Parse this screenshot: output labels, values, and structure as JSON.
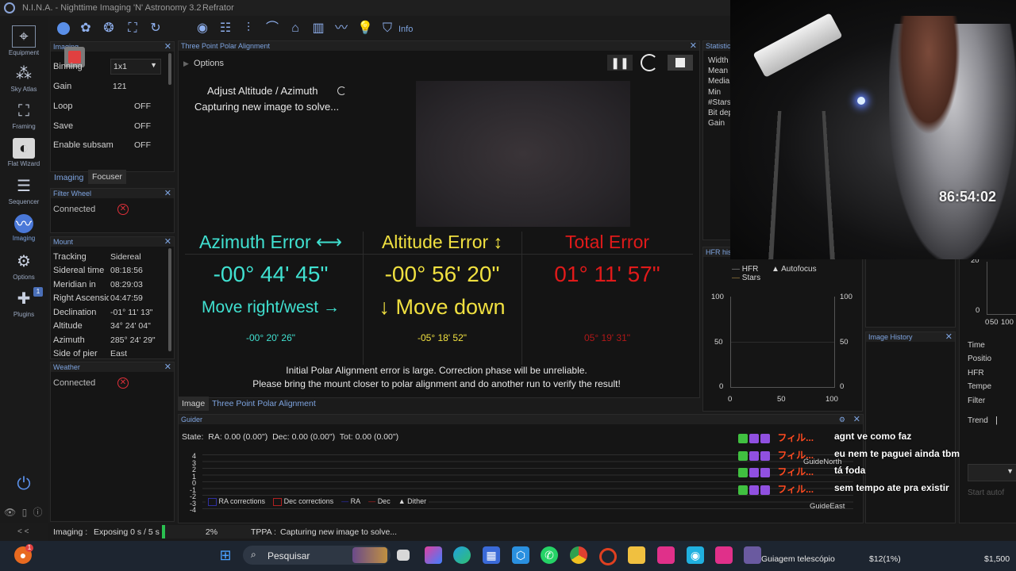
{
  "app": {
    "title": "N.I.N.A. - Nighttime Imaging 'N' Astronomy 3.2",
    "profile": "Refrator",
    "info_label": "Info"
  },
  "sidebar": {
    "items": [
      {
        "label": "Equipment",
        "icon": "telescope-icon"
      },
      {
        "label": "Sky Atlas",
        "icon": "star-map-icon"
      },
      {
        "label": "Framing",
        "icon": "framing-icon"
      },
      {
        "label": "Flat Wizard",
        "icon": "flat-wizard-icon"
      },
      {
        "label": "Sequencer",
        "icon": "sequencer-icon"
      },
      {
        "label": "Imaging",
        "icon": "imaging-icon"
      },
      {
        "label": "Options",
        "icon": "gear-icon"
      },
      {
        "label": "Plugins",
        "icon": "puzzle-icon",
        "badge": "1"
      }
    ],
    "collapse_label": "< <"
  },
  "imaging_panel": {
    "title": "Imaging",
    "rows": [
      {
        "label": "Binning",
        "value": "1x1"
      },
      {
        "label": "Gain",
        "value": "121"
      },
      {
        "label": "Loop",
        "value": "OFF"
      },
      {
        "label": "Save",
        "value": "OFF"
      },
      {
        "label": "Enable subsam",
        "value": "OFF"
      }
    ],
    "tabs": [
      "Imaging",
      "Focuser"
    ]
  },
  "filter_wheel": {
    "title": "Filter Wheel",
    "status": "Connected"
  },
  "mount": {
    "title": "Mount",
    "rows": [
      {
        "label": "Tracking",
        "value": "Sidereal"
      },
      {
        "label": "Sidereal time",
        "value": "08:18:56"
      },
      {
        "label": "Meridian in",
        "value": "08:29:03"
      },
      {
        "label": "Right Ascensio",
        "value": "04:47:59"
      },
      {
        "label": "Declination",
        "value": "-01° 11' 13\""
      },
      {
        "label": "Altitude",
        "value": "34° 24' 04\""
      },
      {
        "label": "Azimuth",
        "value": "285° 24' 29\""
      },
      {
        "label": "Side of pier",
        "value": "East"
      }
    ]
  },
  "weather": {
    "title": "Weather",
    "status": "Connected"
  },
  "tppa": {
    "title": "Three Point Polar Alignment",
    "options_label": "Options",
    "step_title": "Adjust Altitude / Azimuth",
    "step_status": "Capturing new image to solve...",
    "azimuth": {
      "label": "Azimuth Error",
      "value": "-00° 44' 45\"",
      "move": "Move right/west",
      "initial": "-00° 20' 26\""
    },
    "altitude": {
      "label": "Altitude Error",
      "value": "-00° 56' 20\"",
      "move": "Move down",
      "initial": "-05° 18' 52\""
    },
    "total": {
      "label": "Total Error",
      "value": "01° 11' 57\"",
      "initial": "05° 19' 31\""
    },
    "warning_line1": "Initial Polar Alignment error is large. Correction phase will be unreliable.",
    "warning_line2": "Please bring the mount closer to polar alignment and do another run to verify the result!",
    "tabs": [
      "Image",
      "Three Point Polar Alignment"
    ],
    "colors": {
      "azimuth": "#40e0d0",
      "altitude": "#f0e040",
      "total": "#e01a1a"
    }
  },
  "statistics": {
    "title": "Statistics",
    "rows": [
      "Width",
      "Mean",
      "Media",
      "Min",
      "#Stars",
      "Bit dep",
      "Gain"
    ]
  },
  "hfr_history": {
    "title": "HFR histo",
    "legend": [
      "HFR",
      "Autofocus",
      "Stars"
    ],
    "y_ticks_left": [
      "100",
      "50",
      "0"
    ],
    "y_ticks_right": [
      "100",
      "50",
      "0"
    ],
    "x_ticks": [
      "0",
      "50",
      "100"
    ]
  },
  "image_history": {
    "title": "Image History"
  },
  "right_panel": {
    "labels": [
      "Time",
      "Positio",
      "HFR",
      "Tempe",
      "Filter",
      "Trend"
    ],
    "y_ticks": [
      "20",
      "0"
    ],
    "x_ticks": [
      "0",
      "50",
      "100"
    ],
    "start_label": "Start autof"
  },
  "guider": {
    "title": "Guider",
    "state_label": "State:",
    "ra": "RA: 0.00 (0.00\")",
    "dec": "Dec: 0.00 (0.00\")",
    "tot": "Tot: 0.00 (0.00\")",
    "y_ticks": [
      "4",
      "3",
      "2",
      "1",
      "0",
      "-1",
      "-2",
      "-3",
      "-4"
    ],
    "legend": [
      "RA corrections",
      "Dec corrections",
      "RA",
      "Dec",
      "Dither"
    ],
    "guide_north": "GuideNorth",
    "guide_east": "GuideEast"
  },
  "webcam": {
    "timer": "86:54:02"
  },
  "chat": [
    {
      "name": "フィル...",
      "message": "agnt ve como faz"
    },
    {
      "name": "フィル...",
      "message": "eu nem te paguei ainda tbm"
    },
    {
      "name": "フィル...",
      "message": "tá foda"
    },
    {
      "name": "フィル...",
      "message": "sem tempo ate pra existir"
    }
  ],
  "status_bar": {
    "imaging_label": "Imaging :",
    "imaging_value": "Exposing 0 s / 5 s",
    "progress": "2%",
    "tppa_label": "TPPA :",
    "tppa_value": "Capturing new image to solve..."
  },
  "taskbar": {
    "search_placeholder": "Pesquisar",
    "notification_text": "Guiagem telescópio",
    "price": "$12(1%)",
    "balance": "$1,500",
    "badge": "1"
  }
}
